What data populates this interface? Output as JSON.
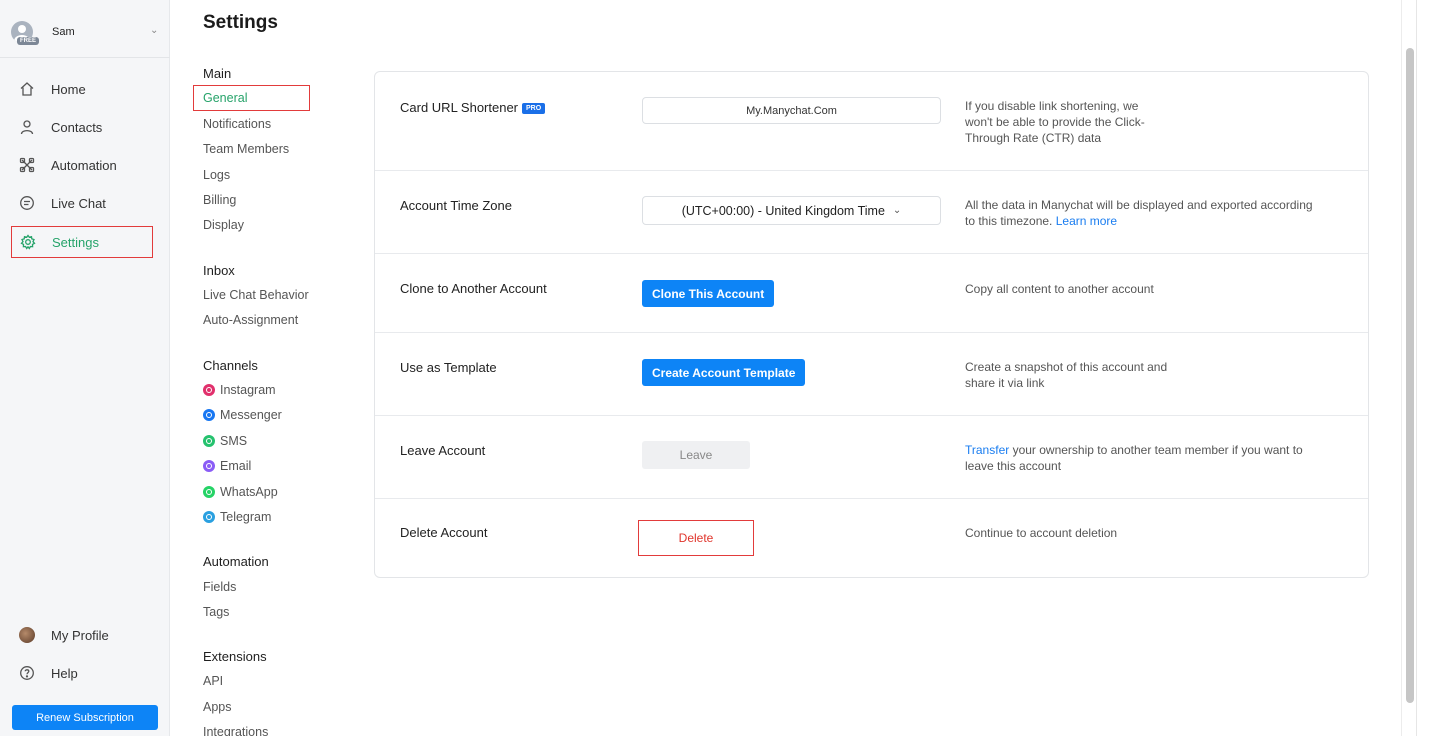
{
  "account": {
    "name": "Sam",
    "plan_badge": "FREE"
  },
  "sidebar": {
    "items": [
      {
        "label": "Home",
        "icon": "home-icon"
      },
      {
        "label": "Contacts",
        "icon": "person-icon"
      },
      {
        "label": "Automation",
        "icon": "automation-icon"
      },
      {
        "label": "Live Chat",
        "icon": "chat-bubble-icon"
      },
      {
        "label": "Settings",
        "icon": "gear-icon"
      }
    ],
    "bottom": [
      {
        "label": "My Profile",
        "icon": "profile-avatar"
      },
      {
        "label": "Help",
        "icon": "help-icon"
      }
    ],
    "renew_label": "Renew Subscription"
  },
  "page": {
    "title": "Settings"
  },
  "subnav": {
    "main": {
      "heading": "Main",
      "links": [
        "General",
        "Notifications",
        "Team Members",
        "Logs",
        "Billing",
        "Display"
      ]
    },
    "inbox": {
      "heading": "Inbox",
      "links": [
        "Live Chat Behavior",
        "Auto-Assignment"
      ]
    },
    "channels": {
      "heading": "Channels",
      "links": [
        "Instagram",
        "Messenger",
        "SMS",
        "Email",
        "WhatsApp",
        "Telegram"
      ]
    },
    "automation": {
      "heading": "Automation",
      "links": [
        "Fields",
        "Tags"
      ]
    },
    "extensions": {
      "heading": "Extensions",
      "links": [
        "API",
        "Apps",
        "Integrations"
      ]
    }
  },
  "settings": {
    "url_shortener": {
      "label": "Card URL Shortener",
      "badge": "PRO",
      "value": "My.Manychat.Com",
      "desc_lines": [
        "If you disable link shortening, we",
        "won't be able to provide the Click-",
        "Through Rate (CTR) data"
      ]
    },
    "timezone": {
      "label": "Account Time Zone",
      "value": "(UTC+00:00) - United Kingdom Time",
      "desc_line1": "All the data in Manychat will be displayed and exported according",
      "desc_line2": "to this timezone.",
      "desc_link": "Learn more"
    },
    "clone": {
      "label": "Clone to Another Account",
      "button": "Clone This Account",
      "desc": "Copy all content to another account"
    },
    "template": {
      "label": "Use as Template",
      "button": "Create Account Template",
      "desc_lines": [
        "Create a snapshot of this account and",
        "share it via link"
      ]
    },
    "leave": {
      "label": "Leave Account",
      "button": "Leave",
      "desc_link": "Transfer",
      "desc_rest": " your ownership to another team member if you want to",
      "desc_line2": "leave this account"
    },
    "delete": {
      "label": "Delete Account",
      "button": "Delete",
      "desc": "Continue to account deletion"
    }
  },
  "colors": {
    "accent_green": "#26a36a",
    "primary_blue": "#0d84f6",
    "danger_red": "#e0342b"
  },
  "channel_colors": [
    "#e1306c",
    "#1877f2",
    "#25c26e",
    "#8a5cf6",
    "#25d366",
    "#2aa0e0"
  ]
}
